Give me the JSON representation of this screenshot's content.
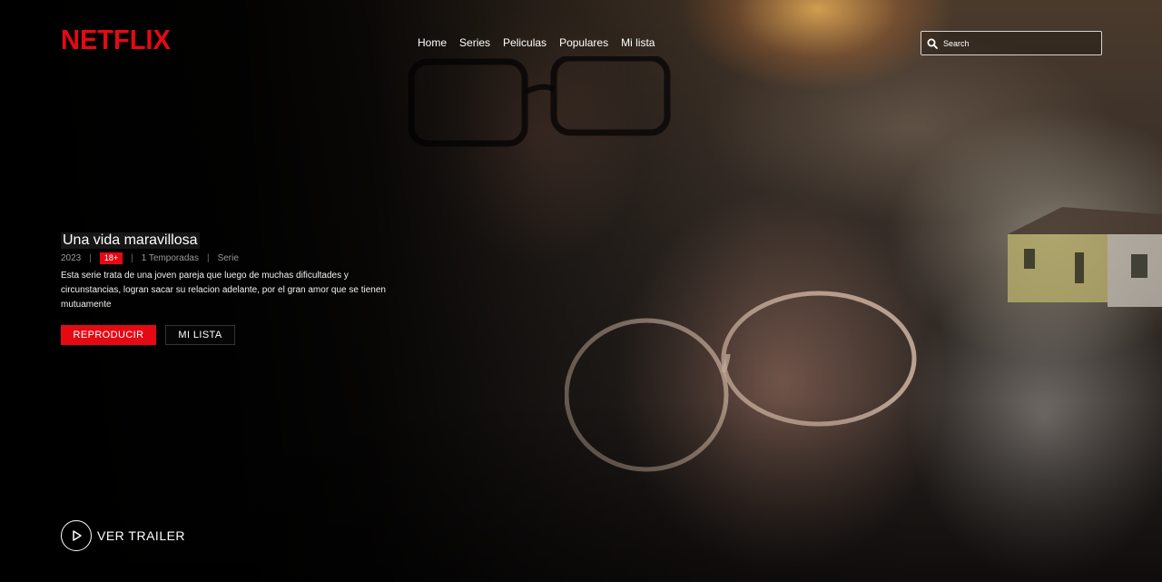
{
  "brand": {
    "logo_text": "NETFLIX",
    "accent": "#e50914"
  },
  "nav": {
    "items": [
      "Home",
      "Series",
      "Peliculas",
      "Populares",
      "Mi lista"
    ]
  },
  "search": {
    "placeholder": "Search",
    "icon": "search-icon"
  },
  "show": {
    "title": "Una vida maravillosa",
    "year": "2023",
    "rating": "18+",
    "seasons": "1 Temporadas",
    "type": "Serie",
    "description": "Esta serie trata de una joven pareja que luego de muchas dificultades y circunstancias, logran sacar su relacion adelante, por el gran amor que se tienen mutuamente"
  },
  "actions": {
    "play_label": "REPRODUCIR",
    "list_label": "MI LISTA",
    "trailer_label": "VER TRAILER",
    "trailer_icon": "play-icon"
  }
}
